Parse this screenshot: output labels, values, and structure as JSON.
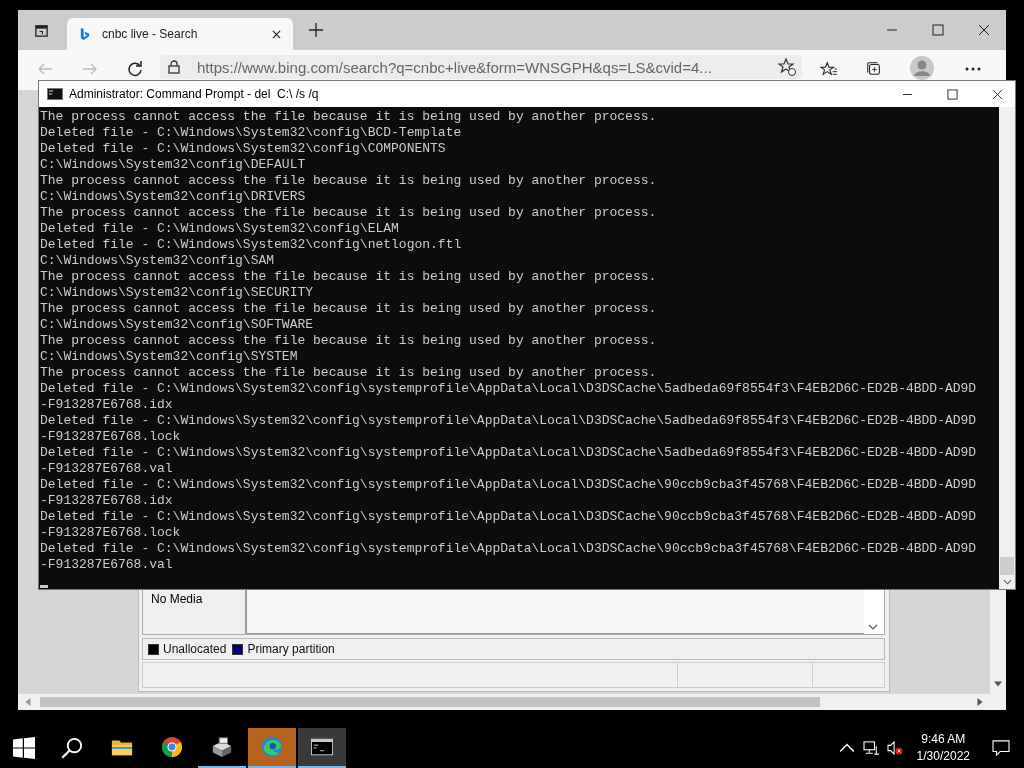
{
  "browser": {
    "tab_title": "cnbc live - Search",
    "address": "https://www.bing.com/search?q=cnbc+live&form=WNSGPH&qs=LS&cvid=4..."
  },
  "disk_management": {
    "media_label": "No Media",
    "legend": [
      {
        "label": "Unallocated",
        "color": "#000000"
      },
      {
        "label": "Primary partition",
        "color": "#000080"
      }
    ]
  },
  "console": {
    "title": "Administrator: Command Prompt - del  C:\\ /s /q",
    "lines": [
      "The process cannot access the file because it is being used by another process.",
      "Deleted file - C:\\Windows\\System32\\config\\BCD-Template",
      "Deleted file - C:\\Windows\\System32\\config\\COMPONENTS",
      "C:\\Windows\\System32\\config\\DEFAULT",
      "The process cannot access the file because it is being used by another process.",
      "C:\\Windows\\System32\\config\\DRIVERS",
      "The process cannot access the file because it is being used by another process.",
      "Deleted file - C:\\Windows\\System32\\config\\ELAM",
      "Deleted file - C:\\Windows\\System32\\config\\netlogon.ftl",
      "C:\\Windows\\System32\\config\\SAM",
      "The process cannot access the file because it is being used by another process.",
      "C:\\Windows\\System32\\config\\SECURITY",
      "The process cannot access the file because it is being used by another process.",
      "C:\\Windows\\System32\\config\\SOFTWARE",
      "The process cannot access the file because it is being used by another process.",
      "C:\\Windows\\System32\\config\\SYSTEM",
      "The process cannot access the file because it is being used by another process.",
      "Deleted file - C:\\Windows\\System32\\config\\systemprofile\\AppData\\Local\\D3DSCache\\5adbeda69f8554f3\\F4EB2D6C-ED2B-4BDD-AD9D",
      "-F913287E6768.idx",
      "Deleted file - C:\\Windows\\System32\\config\\systemprofile\\AppData\\Local\\D3DSCache\\5adbeda69f8554f3\\F4EB2D6C-ED2B-4BDD-AD9D",
      "-F913287E6768.lock",
      "Deleted file - C:\\Windows\\System32\\config\\systemprofile\\AppData\\Local\\D3DSCache\\5adbeda69f8554f3\\F4EB2D6C-ED2B-4BDD-AD9D",
      "-F913287E6768.val",
      "Deleted file - C:\\Windows\\System32\\config\\systemprofile\\AppData\\Local\\D3DSCache\\90ccb9cba3f45768\\F4EB2D6C-ED2B-4BDD-AD9D",
      "-F913287E6768.idx",
      "Deleted file - C:\\Windows\\System32\\config\\systemprofile\\AppData\\Local\\D3DSCache\\90ccb9cba3f45768\\F4EB2D6C-ED2B-4BDD-AD9D",
      "-F913287E6768.lock",
      "Deleted file - C:\\Windows\\System32\\config\\systemprofile\\AppData\\Local\\D3DSCache\\90ccb9cba3f45768\\F4EB2D6C-ED2B-4BDD-AD9D",
      "-F913287E6768.val"
    ]
  },
  "taskbar": {
    "apps": [
      {
        "kind": "explorer",
        "running": false,
        "flashing": false,
        "focused": false
      },
      {
        "kind": "chrome",
        "running": false,
        "flashing": false,
        "focused": false
      },
      {
        "kind": "server",
        "running": true,
        "flashing": false,
        "focused": false
      },
      {
        "kind": "edge",
        "running": true,
        "flashing": true,
        "focused": false
      },
      {
        "kind": "cmd",
        "running": true,
        "flashing": false,
        "focused": true
      }
    ],
    "time": "9:46 AM",
    "date": "1/30/2022"
  }
}
